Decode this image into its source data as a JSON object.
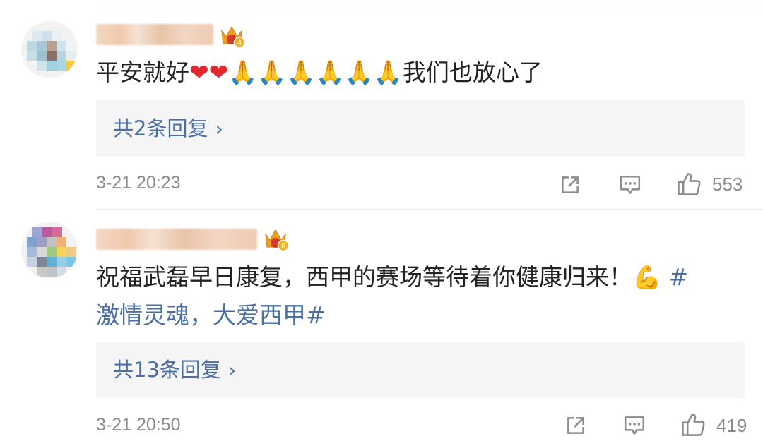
{
  "comments": [
    {
      "text_main": "平安就好",
      "hearts": "❤❤",
      "prayers": "🙏🙏🙏🙏🙏🙏",
      "text_tail": "我们也放心了",
      "vip_level": "4",
      "replies_label": "共2条回复",
      "time": "3-21 20:23",
      "likes": "553"
    },
    {
      "text_line1": "祝福武磊早日康复，西甲的赛场等待着你健康归来！",
      "emoji": "💪",
      "hashtag_start": "#",
      "text_line2_hashtag": "激情灵魂，大爱西甲#",
      "vip_level": "6",
      "replies_label": "共13条回复",
      "time": "3-21 20:50",
      "likes": "419"
    }
  ],
  "icons": {
    "share": "share-icon",
    "comment": "comment-icon",
    "like": "thumbs-up-icon",
    "chevron": "chevron-right-icon",
    "crown": "crown-icon"
  },
  "colors": {
    "link": "#4a6fa5",
    "text": "#222222",
    "meta": "#8c8c8c",
    "reply_bg": "#f5f5f5",
    "crown": "#f0a020"
  }
}
